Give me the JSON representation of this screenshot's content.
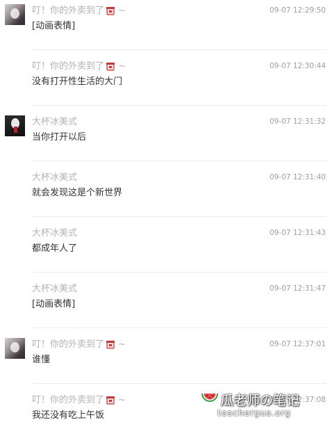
{
  "messages": [
    {
      "sender": "叮！你的外卖到了",
      "suffix": "~",
      "time": "09-07 12:29:50",
      "text": "[动画表情]",
      "avatar": "takeout-avatar"
    },
    {
      "sender": "叮！你的外卖到了",
      "suffix": "~",
      "time": "09-07 12:30:44",
      "text": "没有打开性生活的大门"
    },
    {
      "sender": "大杯冰美式",
      "time": "09-07 12:31:32",
      "text": "当你打开以后",
      "avatar": "coffee-avatar"
    },
    {
      "sender": "大杯冰美式",
      "time": "09-07 12:31:40",
      "text": "就会发现这是个新世界"
    },
    {
      "sender": "大杯冰美式",
      "time": "09-07 12:31:43",
      "text": "都成年人了"
    },
    {
      "sender": "大杯冰美式",
      "time": "09-07 12:31:47",
      "text": "[动画表情]"
    },
    {
      "sender": "叮！你的外卖到了",
      "suffix": "~",
      "time": "09-07 12:37:01",
      "text": "谁懂",
      "avatar": "takeout-avatar"
    },
    {
      "sender": "叮！你的外卖到了",
      "suffix": "~",
      "time": "09-07 12:37:08",
      "text": "我还没有吃上午饭"
    }
  ],
  "watermark": {
    "title": "瓜老师の笔记",
    "url": "teachergua.org"
  },
  "colors": {
    "name": "#b3b3b3",
    "time": "#9e9e9e",
    "text": "#333333",
    "divider": "#ececec"
  }
}
